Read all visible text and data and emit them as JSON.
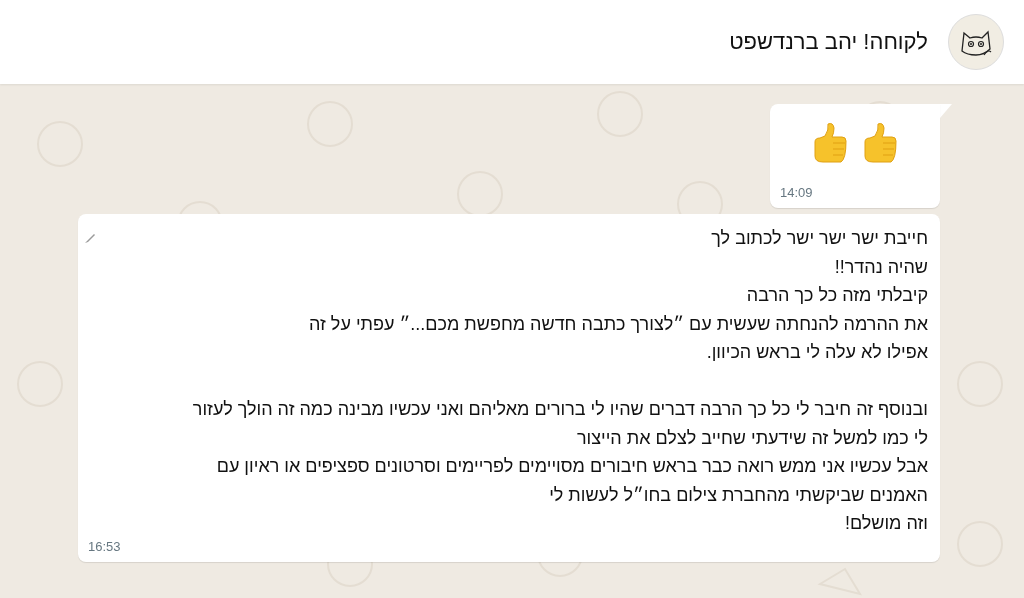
{
  "header": {
    "contact_name": "לקוחה! יהב ברנדשפט"
  },
  "messages": [
    {
      "kind": "emoji",
      "emojis": [
        {
          "kind": "thumbs_up"
        },
        {
          "kind": "thumbs_up"
        }
      ],
      "time": "14:09",
      "tail": true
    },
    {
      "kind": "text",
      "paragraphs": [
        [
          "חייבת ישר ישר ישר לכתוב לך",
          "שהיה נהדר!!",
          "קיבלתי מזה כל כך הרבה",
          "את ההרמה להנחתה שעשית עם ״לצורך כתבה חדשה מחפשת מכם...״ עפתי על זה",
          "אפילו לא עלה לי בראש הכיוון."
        ],
        [
          "ובנוסף זה חיבר לי כל כך הרבה דברים שהיו לי ברורים מאליהם ואני עכשיו מבינה כמה זה הולך לעזור",
          "לי כמו למשל זה שידעתי שחייב לצלם את הייצור",
          "אבל עכשיו אני ממש רואה כבר בראש חיבורים מסויימים לפריימים וסרטונים ספציפים או ראיון עם",
          "האמנים שביקשתי מהחברת צילום בחו״ל לעשות לי",
          "וזה מושלם!"
        ]
      ],
      "time": "16:53",
      "tail": false,
      "edited": true
    }
  ]
}
